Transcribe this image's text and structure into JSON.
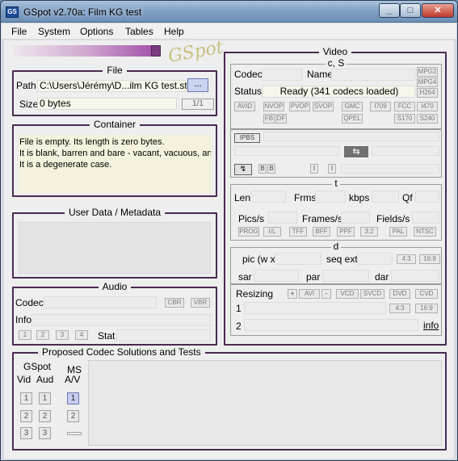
{
  "window": {
    "title": "GSpot v2.70a: Film KG test",
    "icon": "gspot-app-icon",
    "min": "_",
    "max": "□",
    "close": "✕"
  },
  "menu": [
    "File",
    "System",
    "Options",
    "Tables",
    "Help"
  ],
  "logo": "GSpot",
  "file": {
    "title": "File",
    "path_label": "Path",
    "path_value": "C:\\Users\\Jérémy\\D...ilm KG test.stx",
    "browse": "...",
    "size_label": "Size",
    "size_value": "0 bytes",
    "page": "1/1"
  },
  "container": {
    "title": "Container",
    "lines": [
      "File is empty. Its length is zero bytes.",
      "It is blank, barren and bare - vacant, vacuous, and",
      "It is a degenerate case."
    ]
  },
  "userdata": {
    "title": "User Data / Metadata"
  },
  "audio": {
    "title": "Audio",
    "codec_label": "Codec",
    "cbr": "CBR",
    "vbr": "VBR",
    "info_label": "Info",
    "streams": [
      "1",
      "2",
      "3",
      "4"
    ],
    "stat_label": "Stat"
  },
  "proposed": {
    "title": "Proposed Codec Solutions and Tests",
    "gspot": "GSpot",
    "vid": "Vid",
    "aud": "Aud",
    "ms": "MS",
    "av": "A/V",
    "nums": [
      "1",
      "2",
      "3"
    ]
  },
  "video": {
    "title": "Video",
    "cs_title": "c, S",
    "codec_label": "Codec",
    "name_label": "Name",
    "status_label": "Status",
    "status_value": "Ready (341 codecs loaded)",
    "mpeg_btns": [
      "MPG2",
      "MPG4",
      "H264"
    ],
    "row1": [
      "AVID",
      "NVOP",
      "PVOP",
      "SVOP",
      "GMC",
      "I709",
      "FCC",
      "I470"
    ],
    "row2": [
      "FB",
      "DF",
      "QPEL",
      "S170",
      "S240"
    ],
    "ipbs": "IPBS",
    "frame_btns": [
      "B",
      "B",
      "I",
      "I"
    ],
    "t_title": "t",
    "len": "Len",
    "frms": "Frms",
    "kbps": "kbps",
    "qf": "Qf",
    "pics": "Pics/s",
    "frames": "Frames/s",
    "fields": "Fields/s",
    "row3": [
      "PROG",
      "I/L",
      "TFF",
      "BFF",
      "PPF",
      "3:2",
      "PAL",
      "NTSC"
    ],
    "d_title": "d",
    "pic": "pic (w x",
    "seqext": "seq ext",
    "ar43": "4:3",
    "ar169": "16:9",
    "sar": "sar",
    "par": "par",
    "dar": "dar",
    "resizing": "Resizing",
    "plus": "+",
    "avi": "AVI",
    "minus": "-",
    "vcd": "VCD",
    "svcd": "SVCD",
    "dvd": "DVD",
    "cvd": "CVD",
    "r1": "1",
    "r2": "2",
    "r43": "4:3",
    "r169": "16:9",
    "info_link": "info"
  }
}
